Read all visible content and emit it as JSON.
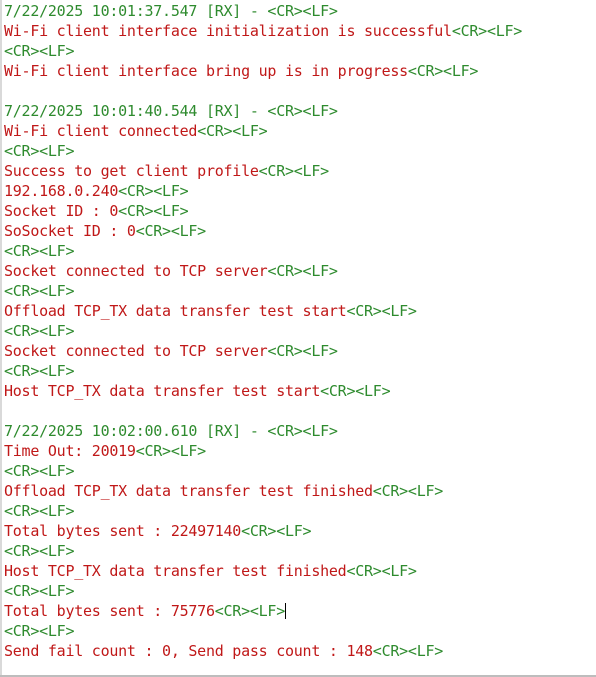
{
  "colors": {
    "header": "#2e8b2e",
    "message": "#c01818",
    "control": "#2e8b2e"
  },
  "icons": {
    "cursor": "text-caret-icon"
  },
  "lines": [
    {
      "kind": "header",
      "text": "7/22/2025 10:01:37.547 [RX] - <CR><LF>"
    },
    {
      "kind": "message",
      "text": "Wi-Fi client interface initialization is successful",
      "suffix": "<CR><LF>"
    },
    {
      "kind": "control",
      "text": "<CR><LF>"
    },
    {
      "kind": "message",
      "text": "Wi-Fi client interface bring up is in progress",
      "suffix": "<CR><LF>"
    },
    {
      "kind": "blank",
      "text": ""
    },
    {
      "kind": "header",
      "text": "7/22/2025 10:01:40.544 [RX] - <CR><LF>"
    },
    {
      "kind": "message",
      "text": "Wi-Fi client connected",
      "suffix": "<CR><LF>"
    },
    {
      "kind": "control",
      "text": "<CR><LF>"
    },
    {
      "kind": "message",
      "text": "Success to get client profile",
      "suffix": "<CR><LF>"
    },
    {
      "kind": "message",
      "text": "192.168.0.240",
      "suffix": "<CR><LF>"
    },
    {
      "kind": "message",
      "text": "Socket ID : 0",
      "suffix": "<CR><LF>"
    },
    {
      "kind": "message",
      "text": "SoSocket ID : 0",
      "suffix": "<CR><LF>"
    },
    {
      "kind": "control",
      "text": "<CR><LF>"
    },
    {
      "kind": "message",
      "text": "Socket connected to TCP server",
      "suffix": "<CR><LF>"
    },
    {
      "kind": "control",
      "text": "<CR><LF>"
    },
    {
      "kind": "message",
      "text": "Offload TCP_TX data transfer test start",
      "suffix": "<CR><LF>"
    },
    {
      "kind": "control",
      "text": "<CR><LF>"
    },
    {
      "kind": "message",
      "text": "Socket connected to TCP server",
      "suffix": "<CR><LF>"
    },
    {
      "kind": "control",
      "text": "<CR><LF>"
    },
    {
      "kind": "message",
      "text": "Host TCP_TX data transfer test start",
      "suffix": "<CR><LF>"
    },
    {
      "kind": "blank",
      "text": ""
    },
    {
      "kind": "header",
      "text": "7/22/2025 10:02:00.610 [RX] - <CR><LF>"
    },
    {
      "kind": "message",
      "text": "Time Out: 20019",
      "suffix": "<CR><LF>"
    },
    {
      "kind": "control",
      "text": "<CR><LF>"
    },
    {
      "kind": "message",
      "text": "Offload TCP_TX data transfer test finished",
      "suffix": "<CR><LF>"
    },
    {
      "kind": "control",
      "text": "<CR><LF>"
    },
    {
      "kind": "message",
      "text": "Total bytes sent : 22497140",
      "suffix": "<CR><LF>"
    },
    {
      "kind": "control",
      "text": "<CR><LF>"
    },
    {
      "kind": "message",
      "text": "Host TCP_TX data transfer test finished",
      "suffix": "<CR><LF>"
    },
    {
      "kind": "control",
      "text": "<CR><LF>"
    },
    {
      "kind": "message",
      "text": "Total bytes sent : 75776",
      "suffix": "<CR><LF>",
      "cursor": true
    },
    {
      "kind": "control",
      "text": "<CR><LF>"
    },
    {
      "kind": "message",
      "text": "Send fail count : 0, Send pass count : 148",
      "suffix": "<CR><LF>"
    }
  ]
}
